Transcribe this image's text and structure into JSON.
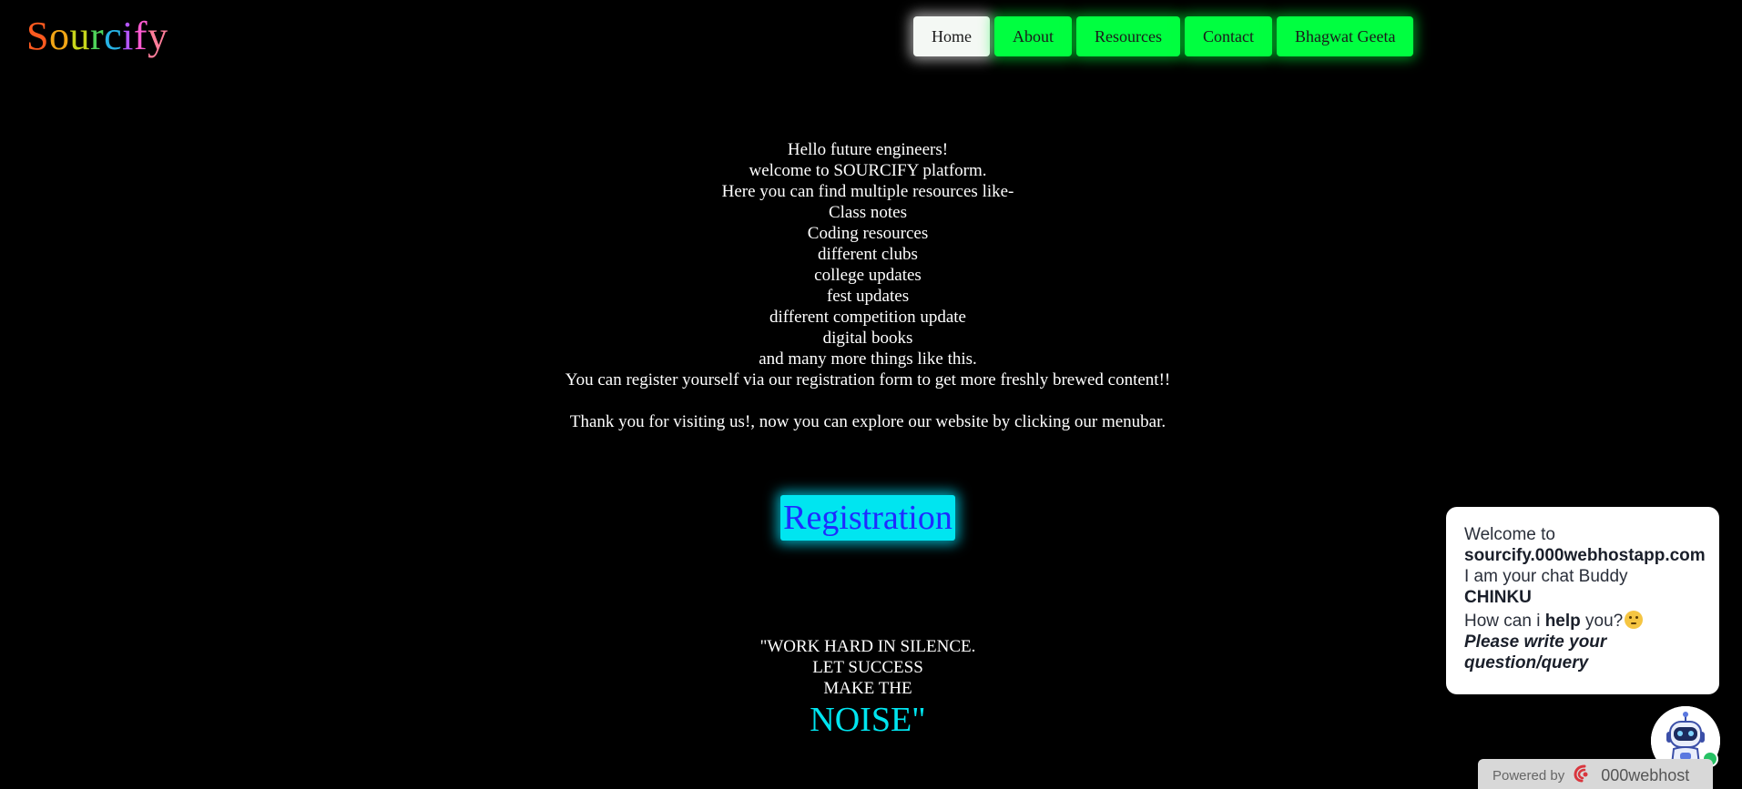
{
  "logo": {
    "letters": [
      "S",
      "o",
      "u",
      "r",
      "c",
      "i",
      "f",
      "y"
    ],
    "colors": [
      "#ff5a1f",
      "#f2a516",
      "#c8d61c",
      "#4ed45a",
      "#27b3e5",
      "#b456ff",
      "#ff5bd1",
      "#ff7d9a"
    ]
  },
  "nav": {
    "items": [
      {
        "label": "Home",
        "active": true
      },
      {
        "label": "About"
      },
      {
        "label": "Resources"
      },
      {
        "label": "Contact"
      },
      {
        "label": "Bhagwat Geeta"
      }
    ]
  },
  "intro": {
    "lines": [
      "Hello future engineers!",
      "welcome to SOURCIFY platform.",
      "Here you can find multiple resources like-",
      "Class notes",
      "Coding resources",
      "different clubs",
      "college updates",
      "fest updates",
      "different competition update",
      "digital books",
      "and many more things like this.",
      "You can register yourself via our registration form to get more freshly brewed content!!"
    ],
    "closing": "Thank you for visiting us!, now you can explore our website by clicking our menubar."
  },
  "registration": {
    "label": "Registration"
  },
  "quote": {
    "line1": "\"WORK HARD IN SILENCE.",
    "line2": "LET SUCCESS",
    "line3": "MAKE THE",
    "line4": "NOISE\""
  },
  "chat": {
    "welcome": "Welcome to",
    "site": "sourcify.000webhostapp.com",
    "intro": "I am your chat Buddy",
    "bot_name": "CHINKU",
    "ask_prefix": "How can i ",
    "ask_bold": "help",
    "ask_suffix": " you?",
    "prompt_line1": "Please write your",
    "prompt_line2": "question/query",
    "emoji_icon": "thinking-face-emoji"
  },
  "powered": {
    "prefix": "Powered by",
    "brand": "000webhost"
  },
  "colors": {
    "nav_green": "#00ff40",
    "accent_cyan": "#00e5f0",
    "registration_text": "#1e2cff",
    "background": "#000000"
  }
}
